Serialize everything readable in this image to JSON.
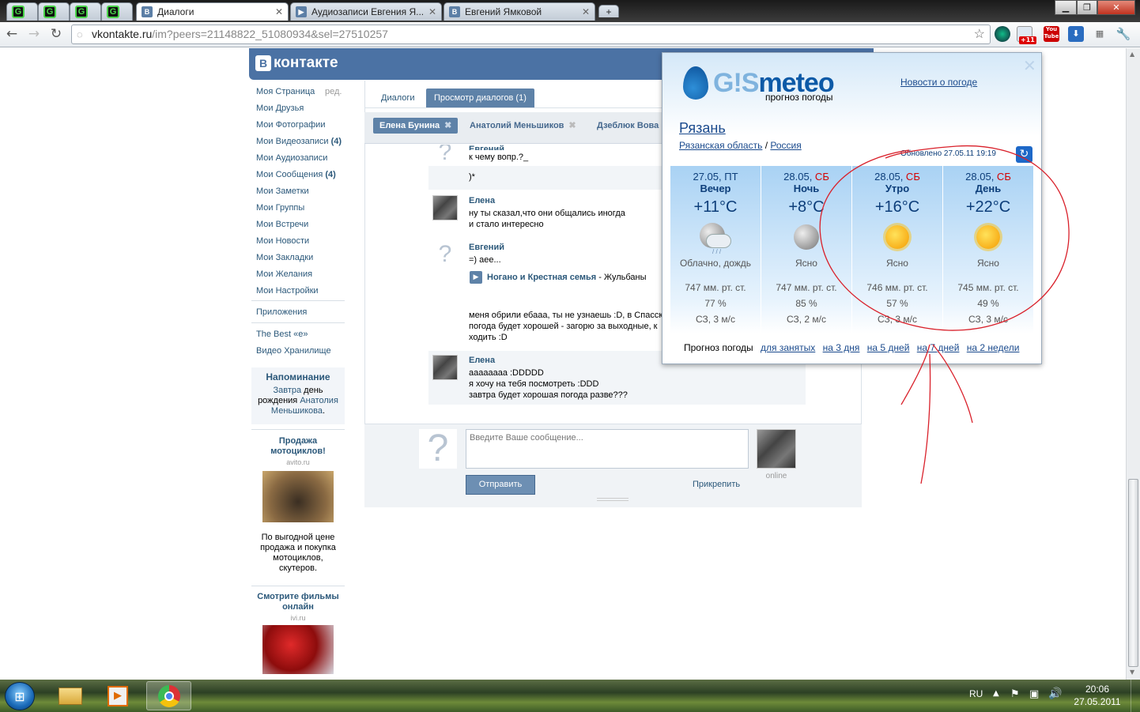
{
  "browser": {
    "tabs": [
      {
        "title": "Диалоги",
        "favicon": "В"
      },
      {
        "title": "Аудиозаписи Евгения Я...",
        "favicon": "▶"
      },
      {
        "title": "Евгений Ямковой",
        "favicon": "В"
      }
    ],
    "pinned_tabs_icon": "G",
    "new_tab": "+",
    "url_host": "vkontakte.ru",
    "url_path": "/im?peers=21148822_51080934&sel=27510257",
    "ext_badge": "+11",
    "ext_youtube": "You Tube"
  },
  "vk": {
    "logo_letter": "В",
    "logo_text": "контакте",
    "menu": [
      {
        "label": "Моя Страница"
      },
      {
        "label": "Мои Друзья"
      },
      {
        "label": "Мои Фотографии"
      },
      {
        "label": "Мои Видеозаписи",
        "count": "(4)"
      },
      {
        "label": "Мои Аудиозаписи"
      },
      {
        "label": "Мои Сообщения",
        "count": "(4)"
      },
      {
        "label": "Мои Заметки"
      },
      {
        "label": "Мои Группы"
      },
      {
        "label": "Мои Встречи"
      },
      {
        "label": "Мои Новости"
      },
      {
        "label": "Мои Закладки"
      },
      {
        "label": "Мои Желания"
      },
      {
        "label": "Мои Настройки"
      }
    ],
    "edit_label": "ред.",
    "apps": "Приложения",
    "app_links": [
      "The Best «е»",
      "Видео Хранилище"
    ],
    "reminder": {
      "title": "Напоминание",
      "link1": "Завтра",
      "text1": " день рождения ",
      "link2": "Анатолия Меньшикова",
      "text2": "."
    },
    "ads": [
      {
        "title": "Продажа мотоциклов!",
        "domain": "avito.ru",
        "text": "По выгодной цене продажа и покупка мотоциклов, скутеров."
      },
      {
        "title": "Смотрите фильмы онлайн",
        "domain": "ivi.ru"
      }
    ],
    "dialog_tabs": [
      "Диалоги",
      "Просмотр диалогов (1)"
    ],
    "peers": [
      "Елена Бунина",
      "Анатолий Меньшиков",
      "Дзеблюк Вова"
    ],
    "peer_close": "✖",
    "messages": [
      {
        "name": "Евгений",
        "lines": [
          "к чему вопр.?_"
        ]
      },
      {
        "name": "",
        "lines": [
          ")*"
        ]
      },
      {
        "name": "Елена",
        "lines": [
          "ну ты сказал,что они общались иногда",
          "и стало интересно"
        ]
      },
      {
        "name": "Евгений",
        "lines": [
          "=) аее..."
        ]
      },
      {
        "name": "",
        "lines": [
          "меня обрили ебааа, ты не узнаешь :D, в Спасск",
          "погода будет хорошей - загорю за выходные, к",
          "ходить :D"
        ]
      },
      {
        "name": "Елена",
        "lines": [
          "аааааааа :DDDDD",
          "я хочу на тебя посмотреть :DDD",
          "завтра будет хорошая погода разве???"
        ]
      }
    ],
    "audio": {
      "title": "Ногано и Крестная семья",
      "rest": " - Жульбаны"
    },
    "unknown_avatar": "?",
    "composer": {
      "placeholder": "Введите Ваше сообщение...",
      "send": "Отправить",
      "attach": "Прикрепить",
      "status": "online"
    }
  },
  "gismeteo": {
    "logo_a": "G!S",
    "logo_b": "meteo",
    "tagline": "прогноз погоды",
    "news": "Новости о погоде",
    "close": "✕",
    "city": "Рязань",
    "region": "Рязанская область",
    "slash": " / ",
    "country": "Россия",
    "updated": "Обновлено 27.05.11 19:19",
    "refresh": "↻",
    "days": [
      {
        "date": "27.05,",
        "weekday": " ПТ",
        "weekend": false,
        "time": "Вечер",
        "temp": "+11°C",
        "icon": "cloud-rain-icon",
        "desc": "Облачно, дождь",
        "pressure": "747 мм. рт. ст.",
        "humidity": "77 %",
        "wind": "СЗ, 3 м/с"
      },
      {
        "date": "28.05,",
        "weekday": " СБ",
        "weekend": true,
        "time": "Ночь",
        "temp": "+8°C",
        "icon": "moon-icon",
        "desc": "Ясно",
        "pressure": "747 мм. рт. ст.",
        "humidity": "85 %",
        "wind": "СЗ, 2 м/с"
      },
      {
        "date": "28.05,",
        "weekday": " СБ",
        "weekend": true,
        "time": "Утро",
        "temp": "+16°C",
        "icon": "sun-icon",
        "desc": "Ясно",
        "pressure": "746 мм. рт. ст.",
        "humidity": "57 %",
        "wind": "СЗ, 3 м/с"
      },
      {
        "date": "28.05,",
        "weekday": " СБ",
        "weekend": true,
        "time": "День",
        "temp": "+22°C",
        "icon": "sun-icon",
        "desc": "Ясно",
        "pressure": "745 мм. рт. ст.",
        "humidity": "49 %",
        "wind": "СЗ, 3 м/с"
      }
    ],
    "forecast_label": "Прогноз погоды",
    "forecast_links": [
      "для занятых",
      "на 3 дня",
      "на 5 дней",
      "на 7 дней",
      "на 2 недели"
    ],
    "weekend_color": "#d40000"
  },
  "taskbar": {
    "lang": "RU",
    "time": "20:06",
    "date": "27.05.2011"
  },
  "annotation_color": "#d9202a"
}
